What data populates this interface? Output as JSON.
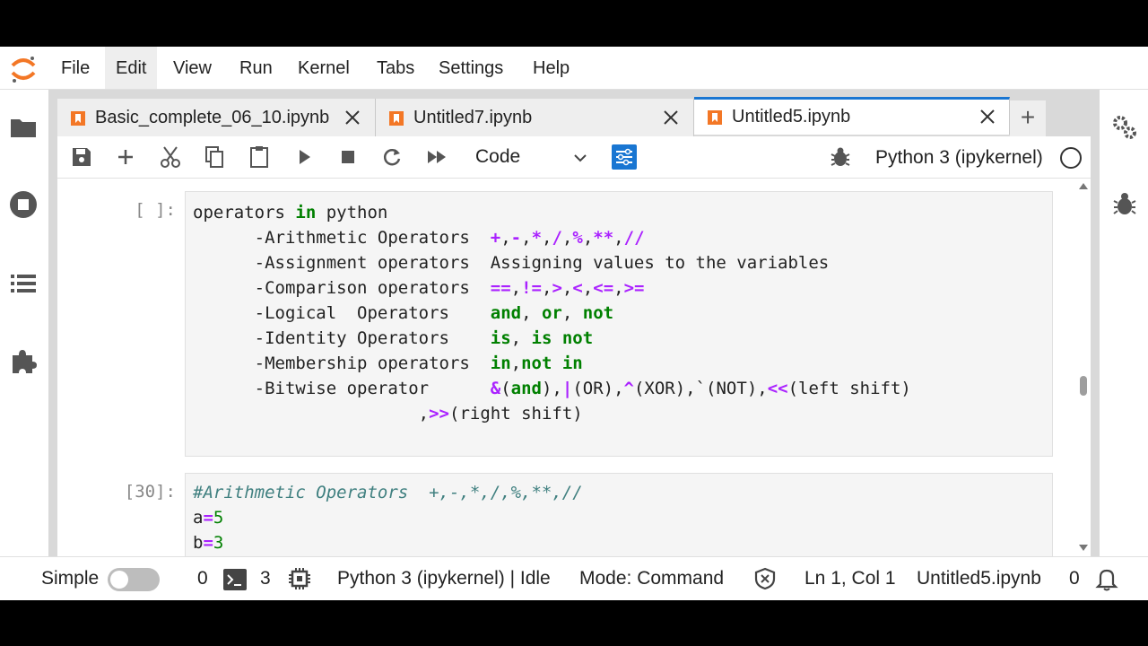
{
  "menubar": {
    "items": [
      "File",
      "Edit",
      "View",
      "Run",
      "Kernel",
      "Tabs",
      "Settings",
      "Help"
    ],
    "active": "Edit"
  },
  "tabs": [
    {
      "label": "Basic_complete_06_10.ipynb",
      "active": false
    },
    {
      "label": "Untitled7.ipynb",
      "active": false
    },
    {
      "label": "Untitled5.ipynb",
      "active": true
    }
  ],
  "tab_add_label": "+",
  "toolbar": {
    "cell_type": "Code",
    "kernel_name": "Python 3 (ipykernel)"
  },
  "cells": [
    {
      "prompt": "[ ]:",
      "lines": [
        {
          "parts": [
            {
              "t": "operators ",
              "c": ""
            },
            {
              "t": "in",
              "c": "kw"
            },
            {
              "t": " python",
              "c": ""
            }
          ]
        },
        {
          "parts": [
            {
              "t": "      -",
              "c": ""
            },
            {
              "t": "Arithmetic Operators  ",
              "c": ""
            },
            {
              "t": "+",
              "c": "op"
            },
            {
              "t": ",",
              "c": ""
            },
            {
              "t": "-",
              "c": "op"
            },
            {
              "t": ",",
              "c": ""
            },
            {
              "t": "*",
              "c": "op"
            },
            {
              "t": ",",
              "c": ""
            },
            {
              "t": "/",
              "c": "op"
            },
            {
              "t": ",",
              "c": ""
            },
            {
              "t": "%",
              "c": "op"
            },
            {
              "t": ",",
              "c": ""
            },
            {
              "t": "**",
              "c": "op"
            },
            {
              "t": ",",
              "c": ""
            },
            {
              "t": "//",
              "c": "op"
            }
          ]
        },
        {
          "parts": [
            {
              "t": "      -",
              "c": ""
            },
            {
              "t": "Assignment operators  Assigning values to the variables",
              "c": ""
            }
          ]
        },
        {
          "parts": [
            {
              "t": "      -",
              "c": ""
            },
            {
              "t": "Comparison operators  ",
              "c": ""
            },
            {
              "t": "==",
              "c": "op"
            },
            {
              "t": ",",
              "c": ""
            },
            {
              "t": "!=",
              "c": "op"
            },
            {
              "t": ",",
              "c": ""
            },
            {
              "t": ">",
              "c": "op"
            },
            {
              "t": ",",
              "c": ""
            },
            {
              "t": "<",
              "c": "op"
            },
            {
              "t": ",",
              "c": ""
            },
            {
              "t": "<=",
              "c": "op"
            },
            {
              "t": ",",
              "c": ""
            },
            {
              "t": ">=",
              "c": "op"
            }
          ]
        },
        {
          "parts": [
            {
              "t": "      -",
              "c": ""
            },
            {
              "t": "Logical  Operators    ",
              "c": ""
            },
            {
              "t": "and",
              "c": "kw"
            },
            {
              "t": ", ",
              "c": ""
            },
            {
              "t": "or",
              "c": "kw"
            },
            {
              "t": ", ",
              "c": ""
            },
            {
              "t": "not",
              "c": "kw"
            }
          ]
        },
        {
          "parts": [
            {
              "t": "      -",
              "c": ""
            },
            {
              "t": "Identity Operators    ",
              "c": ""
            },
            {
              "t": "is",
              "c": "kw"
            },
            {
              "t": ", ",
              "c": ""
            },
            {
              "t": "is not",
              "c": "kw"
            }
          ]
        },
        {
          "parts": [
            {
              "t": "      -",
              "c": ""
            },
            {
              "t": "Membership operators  ",
              "c": ""
            },
            {
              "t": "in",
              "c": "kw"
            },
            {
              "t": ",",
              "c": ""
            },
            {
              "t": "not in",
              "c": "kw"
            }
          ]
        },
        {
          "parts": [
            {
              "t": "      -",
              "c": ""
            },
            {
              "t": "Bitwise operator      ",
              "c": ""
            },
            {
              "t": "&",
              "c": "op"
            },
            {
              "t": "(",
              "c": ""
            },
            {
              "t": "and",
              "c": "kw"
            },
            {
              "t": "),",
              "c": ""
            },
            {
              "t": "|",
              "c": "op"
            },
            {
              "t": "(OR),",
              "c": ""
            },
            {
              "t": "^",
              "c": "op"
            },
            {
              "t": "(XOR),`(NOT),",
              "c": ""
            },
            {
              "t": "<<",
              "c": "op"
            },
            {
              "t": "(left shift)",
              "c": ""
            }
          ]
        },
        {
          "parts": [
            {
              "t": "                      ,",
              "c": ""
            },
            {
              "t": ">>",
              "c": "op"
            },
            {
              "t": "(right shift)",
              "c": ""
            }
          ]
        }
      ]
    },
    {
      "prompt": "[30]:",
      "lines": [
        {
          "parts": [
            {
              "t": "#Arithmetic Operators  +,-,*,/,%,**,//",
              "c": "cm"
            }
          ]
        },
        {
          "parts": [
            {
              "t": "a",
              "c": ""
            },
            {
              "t": "=",
              "c": "op"
            },
            {
              "t": "5",
              "c": "num"
            }
          ]
        },
        {
          "parts": [
            {
              "t": "b",
              "c": ""
            },
            {
              "t": "=",
              "c": "op"
            },
            {
              "t": "3",
              "c": "num"
            }
          ]
        }
      ]
    }
  ],
  "statusbar": {
    "mode_label": "Simple",
    "terminals_count": "0",
    "kernels_count": "3",
    "kernel_status": "Python 3 (ipykernel) | Idle",
    "mode": "Mode: Command",
    "cursor": "Ln 1, Col 1",
    "filename": "Untitled5.ipynb",
    "notifications": "0"
  },
  "colors": {
    "accent": "#1976d2",
    "notebook_icon": "#f37726",
    "keyword": "#008000",
    "operator": "#aa22ff",
    "comment": "#408080"
  }
}
